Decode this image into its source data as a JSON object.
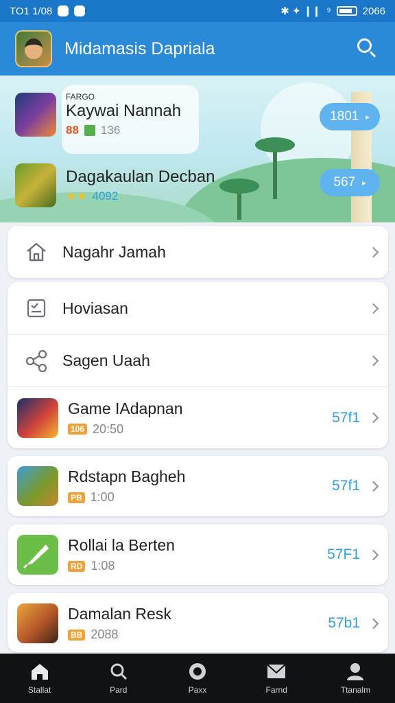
{
  "status": {
    "time": "TO1 1/08",
    "right_text": "2066",
    "signal": "✱ ✦ ❙❙  ⁹"
  },
  "appbar": {
    "title": "Midamasis Dapriala"
  },
  "featured": [
    {
      "tiny": "FARGO",
      "name": "Kaywai Nannah",
      "meta_primary": "88",
      "meta_secondary": "136",
      "pill": "1801"
    },
    {
      "tiny": "",
      "name": "Dagakaulan Decban",
      "meta_primary": "",
      "meta_secondary": "4092",
      "pill": "567"
    }
  ],
  "menu": {
    "home": "Nagahr Jamah",
    "item2": "Hoviasan",
    "item3": "Sagen Uaah"
  },
  "games": [
    {
      "name": "Game IAdapnan",
      "tag": "106",
      "time": "20:50",
      "score": "57f1"
    },
    {
      "name": "Rdstapn Bagheh",
      "tag": "PB",
      "time": "1:00",
      "score": "57f1"
    },
    {
      "name": "Rollai la Berten",
      "tag": "RD",
      "time": "1:08",
      "score": "57F1"
    },
    {
      "name": "Damalan Resk",
      "tag": "BB",
      "time": "2088",
      "score": "57b1"
    }
  ],
  "nav": [
    {
      "label": "Stallat",
      "icon": "home-icon"
    },
    {
      "label": "Pard",
      "icon": "search-icon"
    },
    {
      "label": "Paxx",
      "icon": "game-icon"
    },
    {
      "label": "Farnd",
      "icon": "mail-icon"
    },
    {
      "label": "Ttanalm",
      "icon": "profile-icon"
    }
  ],
  "colors": {
    "appbar": "#2a8ad8",
    "accent": "#2f9ee8",
    "nav": "#111214"
  }
}
